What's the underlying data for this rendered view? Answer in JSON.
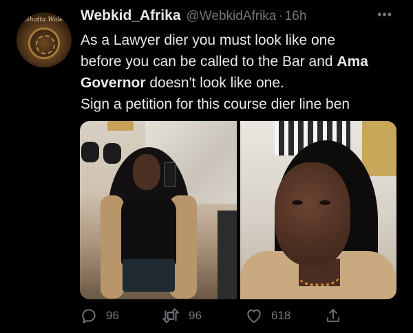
{
  "author": {
    "display_name": "Webkid_Afrika",
    "handle": "@WebkidAfrika",
    "separator": "·",
    "time": "16h",
    "avatar_text": "Shatta Wale"
  },
  "tweet": {
    "line1": "As a Lawyer dier you must look like one",
    "line2_prefix": "before you can be called to the Bar and ",
    "line2_bold": "Ama",
    "line3_bold": "Governor",
    "line3_suffix": " doesn't look like one.",
    "line4": "Sign a petition for this course dier line ben"
  },
  "more_label": "•••",
  "actions": {
    "reply_count": "96",
    "retweet_count": "96",
    "like_count": "618"
  },
  "icons": {
    "reply": "reply-icon",
    "retweet": "retweet-icon",
    "like": "heart-icon",
    "share": "share-icon",
    "more": "more-icon"
  },
  "colors": {
    "background": "#000000",
    "text_primary": "#e7e9ea",
    "text_secondary": "#71767b"
  }
}
